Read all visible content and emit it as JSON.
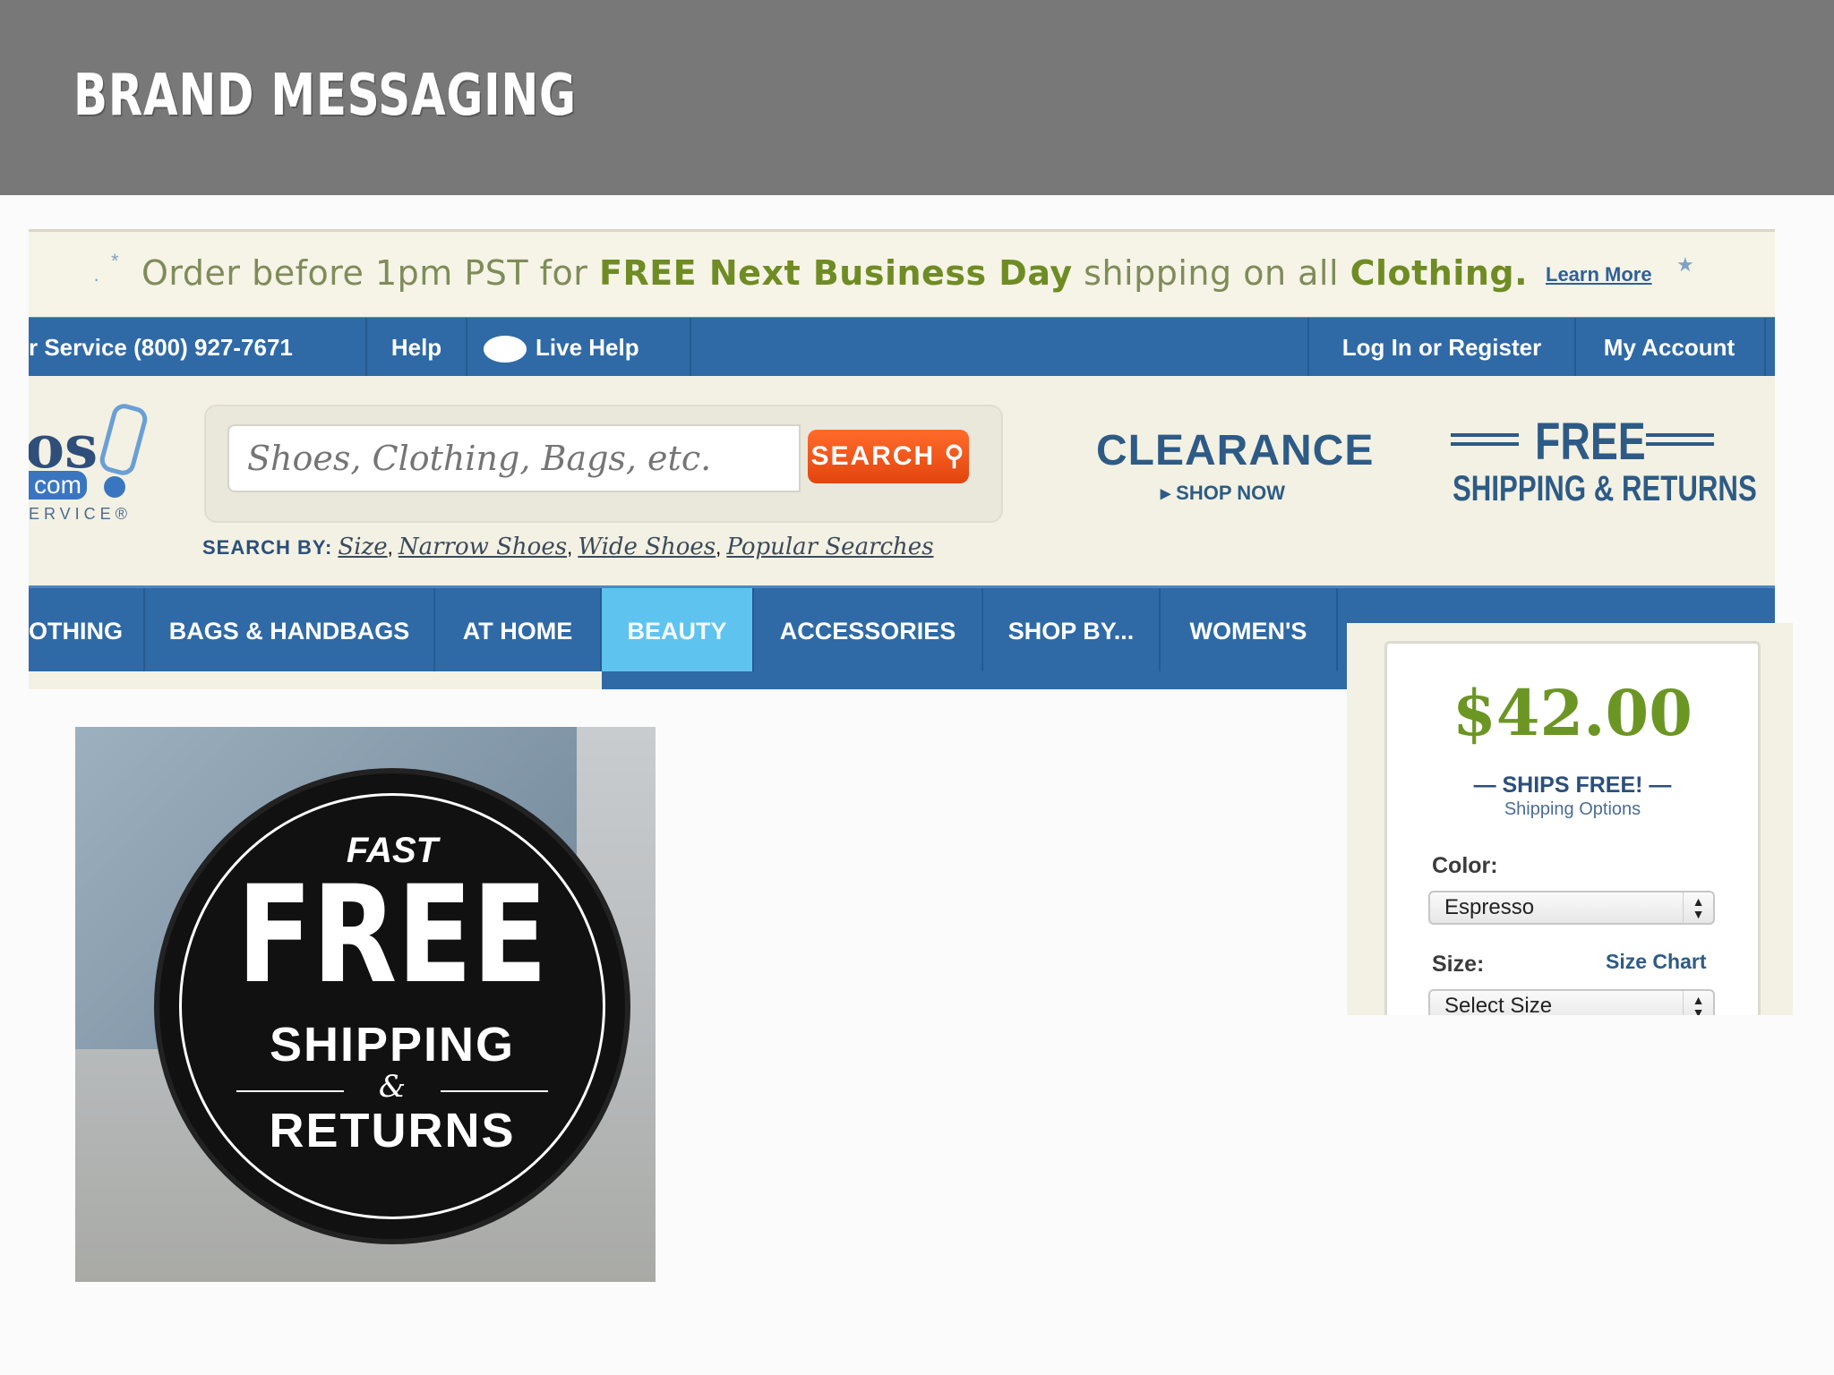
{
  "slide": {
    "title": "BRAND MESSAGING"
  },
  "promo": {
    "text_pre": "Order before 1pm PST for ",
    "text_bold1": "FREE Next Business Day",
    "text_mid": " shipping on all ",
    "text_bold2": "Clothing.",
    "learn_more": "Learn More"
  },
  "topbar": {
    "service": "r Service (800) 927-7671",
    "help": "Help",
    "live_help": "Live Help",
    "login": "Log In or Register",
    "account": "My Account"
  },
  "logo": {
    "os": "os",
    "com": "com",
    "service": "ERVICE®"
  },
  "search": {
    "placeholder": "Shoes, Clothing, Bags, etc.",
    "button": "SEARCH",
    "by_label": "SEARCH BY:",
    "links": [
      "Size",
      "Narrow Shoes",
      "Wide Shoes",
      "Popular Searches"
    ]
  },
  "clearance": {
    "title": "CLEARANCE",
    "cta": "SHOP NOW"
  },
  "free_shipping": {
    "free": "FREE",
    "subtitle": "SHIPPING & RETURNS"
  },
  "nav": {
    "items": [
      "OTHING",
      "BAGS & HANDBAGS",
      "AT HOME",
      "BEAUTY",
      "ACCESSORIES",
      "SHOP BY...",
      "WOMEN'S"
    ],
    "active": "BEAUTY"
  },
  "product": {
    "price": "$42.00",
    "ships_free": "— SHIPS FREE! —",
    "shipping_options": "Shipping Options",
    "color_label": "Color:",
    "color_value": "Espresso",
    "size_label": "Size:",
    "size_chart": "Size Chart",
    "size_value": "Select Size"
  },
  "badge": {
    "fast": "FAST",
    "free": "FREE",
    "shipping": "SHIPPING",
    "amp": "&",
    "returns": "RETURNS"
  },
  "colors": {
    "header_gray": "#787878",
    "nav_blue": "#2f6aa7",
    "active_tab": "#5ec3ef",
    "search_orange": "#f25a1c",
    "price_green": "#6c9624"
  }
}
